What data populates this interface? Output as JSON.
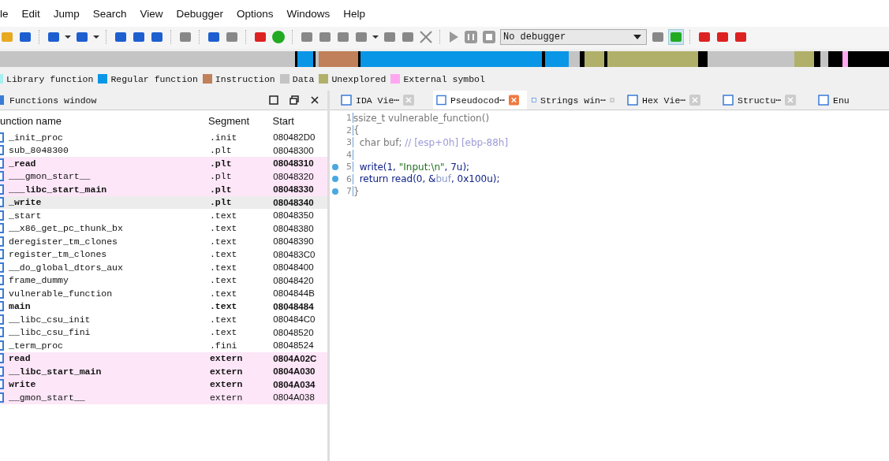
{
  "menu": [
    "le",
    "Edit",
    "Jump",
    "Search",
    "View",
    "Debugger",
    "Options",
    "Windows",
    "Help"
  ],
  "debugger_select": {
    "value": "No debugger"
  },
  "legend": [
    {
      "label": "Library function",
      "color": "#a8f0f0"
    },
    {
      "label": "Regular function",
      "color": "#0a96e6"
    },
    {
      "label": "Instruction",
      "color": "#c0805a"
    },
    {
      "label": "Data",
      "color": "#c4c4c4"
    },
    {
      "label": "Unexplored",
      "color": "#b0b06a"
    },
    {
      "label": "External symbol",
      "color": "#ffa8f0"
    }
  ],
  "functions_window": {
    "title": "Functions window",
    "columns": [
      "unction name",
      "Segment",
      "Start"
    ],
    "rows": [
      {
        "name": "_init_proc",
        "segment": ".init",
        "start": "080482D0",
        "bold": false,
        "highlighted": false,
        "selected": false
      },
      {
        "name": "sub_8048300",
        "segment": ".plt",
        "start": "08048300",
        "bold": false,
        "highlighted": false,
        "selected": false
      },
      {
        "name": "_read",
        "segment": ".plt",
        "start": "08048310",
        "bold": true,
        "highlighted": true,
        "selected": false
      },
      {
        "name": "___gmon_start__",
        "segment": ".plt",
        "start": "08048320",
        "bold": false,
        "highlighted": true,
        "selected": false
      },
      {
        "name": "___libc_start_main",
        "segment": ".plt",
        "start": "08048330",
        "bold": true,
        "highlighted": true,
        "selected": false
      },
      {
        "name": "_write",
        "segment": ".plt",
        "start": "08048340",
        "bold": true,
        "highlighted": false,
        "selected": true
      },
      {
        "name": "_start",
        "segment": ".text",
        "start": "08048350",
        "bold": false,
        "highlighted": false,
        "selected": false
      },
      {
        "name": "__x86_get_pc_thunk_bx",
        "segment": ".text",
        "start": "08048380",
        "bold": false,
        "highlighted": false,
        "selected": false
      },
      {
        "name": "deregister_tm_clones",
        "segment": ".text",
        "start": "08048390",
        "bold": false,
        "highlighted": false,
        "selected": false
      },
      {
        "name": "register_tm_clones",
        "segment": ".text",
        "start": "080483C0",
        "bold": false,
        "highlighted": false,
        "selected": false
      },
      {
        "name": "__do_global_dtors_aux",
        "segment": ".text",
        "start": "08048400",
        "bold": false,
        "highlighted": false,
        "selected": false
      },
      {
        "name": "frame_dummy",
        "segment": ".text",
        "start": "08048420",
        "bold": false,
        "highlighted": false,
        "selected": false
      },
      {
        "name": "vulnerable_function",
        "segment": ".text",
        "start": "0804844B",
        "bold": false,
        "highlighted": false,
        "selected": false
      },
      {
        "name": "main",
        "segment": ".text",
        "start": "08048484",
        "bold": true,
        "highlighted": false,
        "selected": false
      },
      {
        "name": "__libc_csu_init",
        "segment": ".text",
        "start": "080484C0",
        "bold": false,
        "highlighted": false,
        "selected": false
      },
      {
        "name": "__libc_csu_fini",
        "segment": ".text",
        "start": "08048520",
        "bold": false,
        "highlighted": false,
        "selected": false
      },
      {
        "name": "_term_proc",
        "segment": ".fini",
        "start": "08048524",
        "bold": false,
        "highlighted": false,
        "selected": false
      },
      {
        "name": "read",
        "segment": "extern",
        "start": "0804A02C",
        "bold": true,
        "highlighted": true,
        "selected": false
      },
      {
        "name": "__libc_start_main",
        "segment": "extern",
        "start": "0804A030",
        "bold": true,
        "highlighted": true,
        "selected": false
      },
      {
        "name": "write",
        "segment": "extern",
        "start": "0804A034",
        "bold": true,
        "highlighted": true,
        "selected": false
      },
      {
        "name": "__gmon_start__",
        "segment": "extern",
        "start": "0804A038",
        "bold": false,
        "highlighted": true,
        "selected": false
      }
    ]
  },
  "tabs": [
    {
      "label": "IDA Vie⋯",
      "selected": false
    },
    {
      "label": "Pseudocod⋯",
      "selected": true
    },
    {
      "label": "Strings win⋯",
      "selected": false
    },
    {
      "label": "Hex Vie⋯",
      "selected": false
    },
    {
      "label": "Structu⋯",
      "selected": false
    },
    {
      "label": "Enu",
      "selected": false
    }
  ],
  "code": [
    {
      "number": "1",
      "breakpoint": false,
      "parts": [
        {
          "kind": "plain",
          "text": "ssize_t vulnerable_function()"
        }
      ]
    },
    {
      "number": "2",
      "breakpoint": false,
      "parts": [
        {
          "kind": "plain",
          "text": "{"
        }
      ]
    },
    {
      "number": "3",
      "breakpoint": false,
      "parts": [
        {
          "kind": "plain",
          "text": "  char buf; "
        },
        {
          "kind": "comment",
          "text": "// [esp+0h] [ebp-88h]"
        }
      ]
    },
    {
      "number": "4",
      "breakpoint": false
    },
    {
      "number": "5",
      "breakpoint": true,
      "parts": [
        {
          "kind": "call",
          "text": "  write(1, "
        },
        {
          "kind": "string",
          "text": "\"Input:\\n\""
        },
        {
          "kind": "call",
          "text": ", 7u);"
        }
      ]
    },
    {
      "number": "6",
      "breakpoint": true,
      "parts": [
        {
          "kind": "call",
          "text": "  return read(0, &"
        },
        {
          "kind": "var",
          "text": "buf"
        },
        {
          "kind": "call",
          "text": ", 0x100u);"
        }
      ]
    },
    {
      "number": "7",
      "breakpoint": true,
      "parts": [
        {
          "kind": "plain",
          "text": "}"
        }
      ]
    }
  ]
}
